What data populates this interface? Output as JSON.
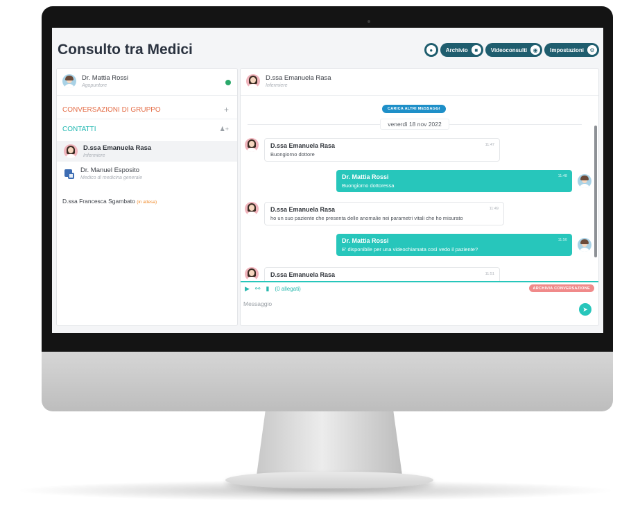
{
  "app": {
    "title": "Consulto tra Medici"
  },
  "top_actions": {
    "archive_label": "Archivio",
    "videoconsults_label": "Videoconsulti",
    "settings_label": "Impostazioni"
  },
  "current_user": {
    "name": "Dr. Mattia Rossi",
    "role": "Agopuntore",
    "status": "online"
  },
  "sidebar": {
    "groups_title": "CONVERSAZIONI DI GRUPPO",
    "contacts_title": "CONTATTI",
    "contacts": [
      {
        "name": "D.ssa Emanuela Rasa",
        "role": "Infermiere",
        "active": true
      },
      {
        "name": "Dr. Manuel Esposito",
        "role": "Medico di medicina generale",
        "active": false
      }
    ],
    "pending_contact": {
      "name": "D.ssa Francesca Sgambato",
      "status": "(in attesa)"
    }
  },
  "chat": {
    "header": {
      "name": "D.ssa Emanuela Rasa",
      "role": "Infermiere"
    },
    "load_more_label": "CARICA ALTRI MESSAGGI",
    "date_separator": "venerdì 18 nov 2022",
    "messages": [
      {
        "author": "D.ssa Emanuela Rasa",
        "text": "Buongiorno dottore",
        "time": "11:47",
        "direction": "in"
      },
      {
        "author": "Dr. Mattia Rossi",
        "text": "Buongiorno dottoressa",
        "time": "11:48",
        "direction": "out"
      },
      {
        "author": "D.ssa Emanuela Rasa",
        "text": "ho un suo paziente che presenta delle anomalie nei parametri vitali che ho misurato",
        "time": "11:49",
        "direction": "in"
      },
      {
        "author": "Dr. Mattia Rossi",
        "text": "E' disponibile per una videochiamata così vedo il paziente?",
        "time": "11:50",
        "direction": "out"
      },
      {
        "author": "D.ssa Emanuela Rasa",
        "text": "",
        "time": "11:51",
        "direction": "in"
      }
    ],
    "attachments_label": "(0 allegati)",
    "archive_label": "ARCHIVIA CONVERSAZIONE",
    "input": {
      "placeholder": "Messaggio",
      "value": ""
    }
  },
  "colors": {
    "brand_dark": "#1f5d6e",
    "teal": "#27c6bb",
    "orange": "#e46e48",
    "online": "#2aa86a"
  }
}
